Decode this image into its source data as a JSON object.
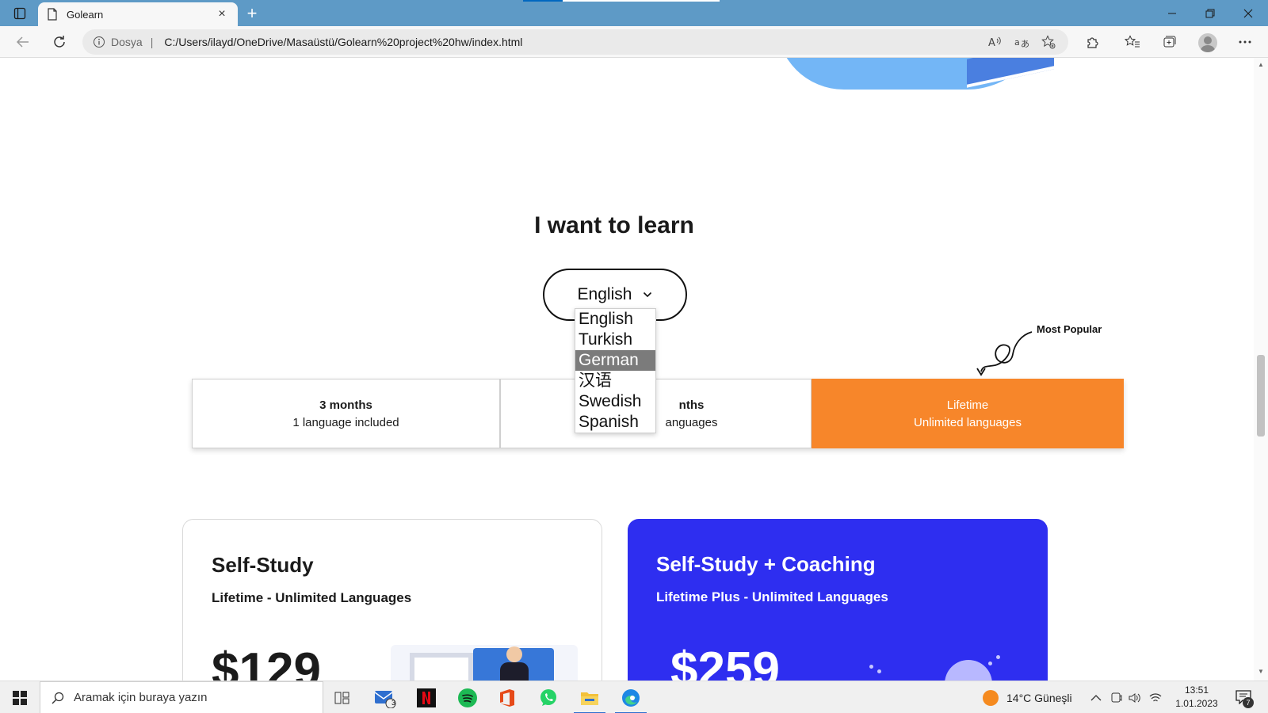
{
  "browser": {
    "tab_title": "Golearn",
    "protocol_label": "Dosya",
    "separator": "|",
    "url": "C:/Users/ilayd/OneDrive/Masaüstü/Golearn%20project%20hw/index.html",
    "new_tab_label": "+",
    "close_tab_label": "×"
  },
  "page": {
    "learn_heading": "I want to learn",
    "language_select": {
      "selected": "English",
      "options": [
        "English",
        "Turkish",
        "German",
        "汉语",
        "Swedish",
        "Spanish"
      ],
      "highlighted_index": 2
    },
    "most_popular_label": "Most Popular",
    "plans": [
      {
        "title": "3 months",
        "subtitle": "1 language included"
      },
      {
        "title": "nths",
        "subtitle": "anguages"
      },
      {
        "title": "Lifetime",
        "subtitle": "Unlimited languages"
      }
    ],
    "cards": [
      {
        "title": "Self-Study",
        "subtitle": "Lifetime - Unlimited Languages",
        "price": "$129"
      },
      {
        "title": "Self-Study + Coaching",
        "subtitle": "Lifetime Plus - Unlimited Languages",
        "price": "$259"
      }
    ],
    "colors": {
      "accent_orange": "#f7862a",
      "card_blue": "#2e2ef0"
    }
  },
  "taskbar": {
    "search_placeholder": "Aramak için buraya yazın",
    "mail_badge": "3",
    "weather": "14°C  Güneşli",
    "time": "13:51",
    "date": "1.01.2023",
    "notification_count": "7"
  }
}
